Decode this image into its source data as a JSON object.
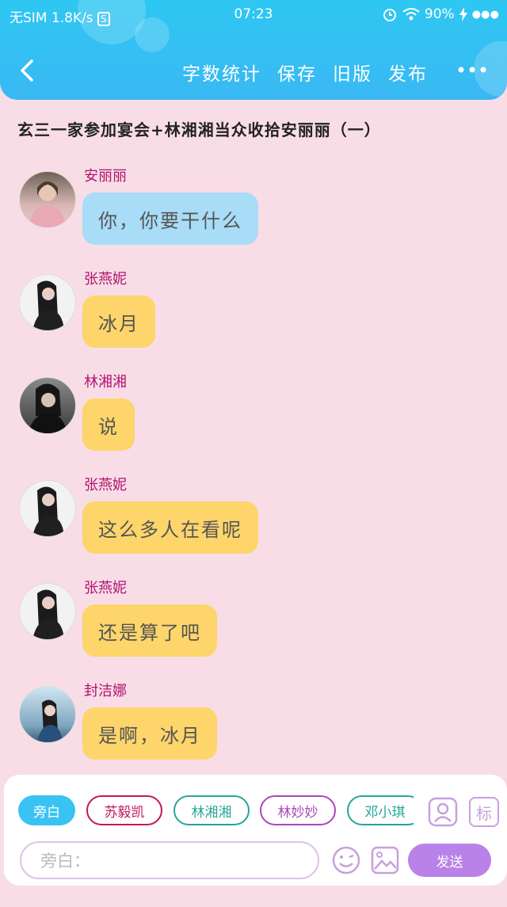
{
  "status_bar": {
    "carrier": "无SIM",
    "speed": "1.8K/s",
    "time": "07:23",
    "battery": "90%"
  },
  "nav": {
    "actions": [
      "字数统计",
      "保存",
      "旧版",
      "发布"
    ]
  },
  "story_title": "玄三一家参加宴会+林湘湘当众收拾安丽丽（一）",
  "messages": [
    {
      "sender": "安丽丽",
      "text": "你，你要干什么",
      "bubble_color": "#a8dcf7"
    },
    {
      "sender": "张燕妮",
      "text": "冰月",
      "bubble_color": "#fdd56a"
    },
    {
      "sender": "林湘湘",
      "text": "说",
      "bubble_color": "#fdd56a"
    },
    {
      "sender": "张燕妮",
      "text": "这么多人在看呢",
      "bubble_color": "#fdd56a"
    },
    {
      "sender": "张燕妮",
      "text": "还是算了吧",
      "bubble_color": "#fdd56a"
    },
    {
      "sender": "封洁娜",
      "text": "是啊，冰月",
      "bubble_color": "#fdd56a"
    }
  ],
  "roles": [
    {
      "label": "旁白",
      "color": "#39c3f3",
      "active": true
    },
    {
      "label": "苏毅凯",
      "color": "#c2185b",
      "active": false
    },
    {
      "label": "林湘湘",
      "color": "#26a69a",
      "active": false
    },
    {
      "label": "林妙妙",
      "color": "#ab47bc",
      "active": false
    },
    {
      "label": "邓小琪",
      "color": "#26a69a",
      "active": false
    }
  ],
  "tag_button": "标",
  "input": {
    "placeholder": "旁白："
  },
  "send_label": "发送",
  "colors": {
    "header": "#36c0f3",
    "background": "#f8dde7",
    "sender_name": "#b0136f",
    "send_button": "#b982e8"
  }
}
